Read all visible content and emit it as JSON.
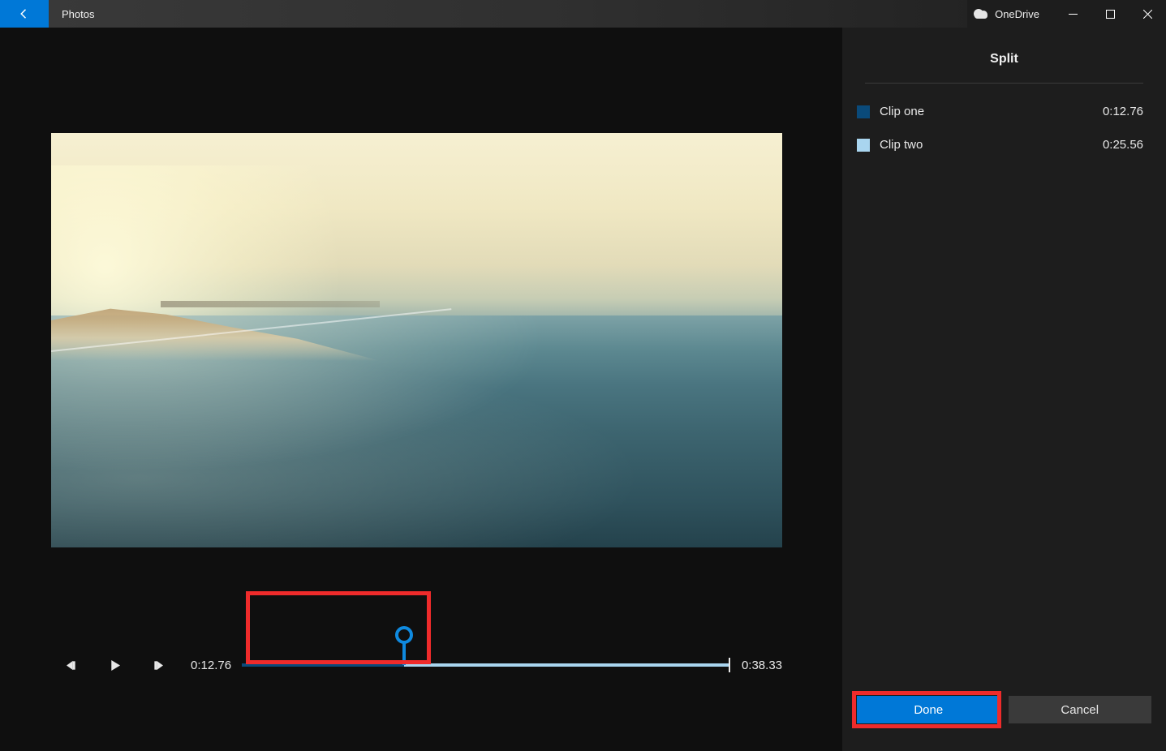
{
  "titlebar": {
    "app_name": "Photos",
    "cloud_service": "OneDrive"
  },
  "sidebar": {
    "title": "Split",
    "clips": [
      {
        "label": "Clip one",
        "duration": "0:12.76",
        "color": "#0a4a7a"
      },
      {
        "label": "Clip two",
        "duration": "0:25.56",
        "color": "#a9d5ef"
      }
    ],
    "done_label": "Done",
    "cancel_label": "Cancel"
  },
  "playback": {
    "current_time": "0:12.76",
    "total_time": "0:38.33",
    "split_position_percent": 33.3
  },
  "colors": {
    "accent": "#0078d7",
    "highlight": "#ef2b2b"
  }
}
